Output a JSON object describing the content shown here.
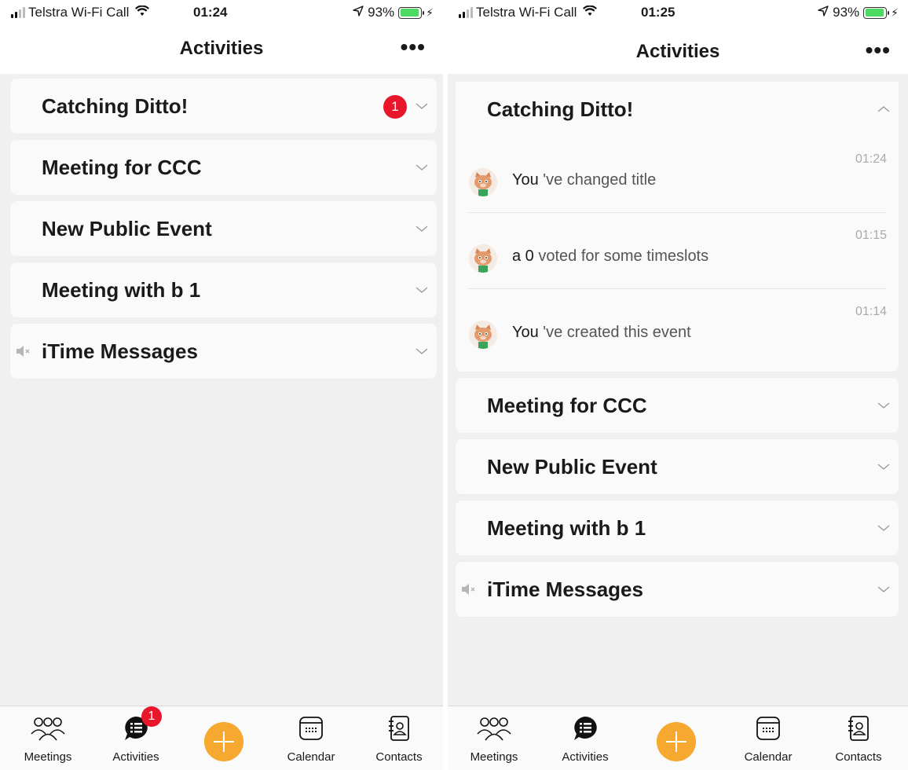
{
  "left": {
    "status": {
      "carrier": "Telstra Wi-Fi Call",
      "time": "01:24",
      "battery": "93%"
    },
    "nav": {
      "title": "Activities",
      "more": "•••"
    },
    "cards": [
      {
        "title": "Catching Ditto!",
        "badge": "1"
      },
      {
        "title": "Meeting for CCC"
      },
      {
        "title": "New Public Event"
      },
      {
        "title": "Meeting with b 1"
      },
      {
        "title": "iTime Messages"
      }
    ],
    "tabs": {
      "meetings": "Meetings",
      "activities": "Activities",
      "calendar": "Calendar",
      "contacts": "Contacts",
      "activities_badge": "1"
    }
  },
  "right": {
    "status": {
      "carrier": "Telstra Wi-Fi Call",
      "time": "01:25",
      "battery": "93%"
    },
    "nav": {
      "title": "Activities",
      "more": "•••"
    },
    "expanded_card": {
      "title": "Catching Ditto!",
      "activities": [
        {
          "time": "01:24",
          "who": "You",
          "text": " 've changed title"
        },
        {
          "time": "01:15",
          "who": "a 0",
          "text": " voted for some timeslots"
        },
        {
          "time": "01:14",
          "who": "You",
          "text": " 've created this event"
        }
      ]
    },
    "cards": [
      {
        "title": "Meeting for CCC"
      },
      {
        "title": "New Public Event"
      },
      {
        "title": "Meeting with b 1"
      },
      {
        "title": "iTime Messages"
      }
    ],
    "tabs": {
      "meetings": "Meetings",
      "activities": "Activities",
      "calendar": "Calendar",
      "contacts": "Contacts"
    }
  },
  "colors": {
    "badge": "#e8152b",
    "plus_button": "#f7a82f",
    "battery": "#4cd964"
  },
  "icons": [
    "signal-icon",
    "wifi-icon",
    "location-arrow-icon",
    "battery-icon",
    "chevron-down-icon",
    "chevron-up-icon",
    "mute-speaker-icon",
    "meetings-people-icon",
    "activities-chat-icon",
    "plus-icon",
    "calendar-icon",
    "contacts-book-icon",
    "cat-avatar-icon"
  ]
}
